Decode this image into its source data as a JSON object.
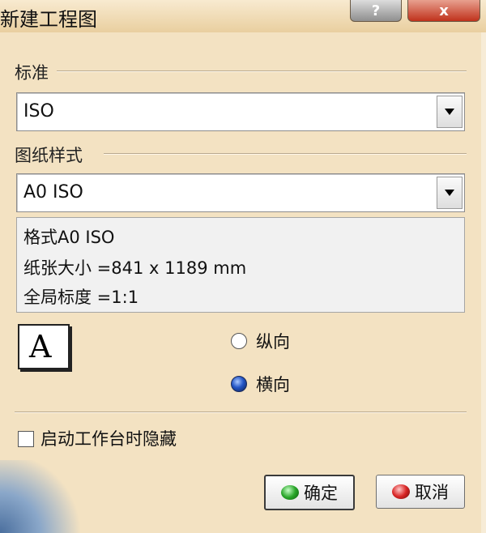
{
  "window": {
    "title": "新建工程图",
    "help_label": "?",
    "close_label": "x"
  },
  "standard": {
    "label": "标准",
    "value": "ISO"
  },
  "sheet_style": {
    "label": "图纸样式",
    "value": "A0 ISO",
    "info": {
      "format": "格式A0 ISO",
      "paper_size": "纸张大小 =841 x 1189 mm",
      "scale": "全局标度 =1:1"
    }
  },
  "orientation": {
    "icon_letter": "A",
    "portrait_label": "纵向",
    "landscape_label": "横向",
    "selected": "landscape"
  },
  "hide_on_start": {
    "label": "启动工作台时隐藏",
    "checked": false
  },
  "buttons": {
    "ok": "确定",
    "cancel": "取消"
  }
}
